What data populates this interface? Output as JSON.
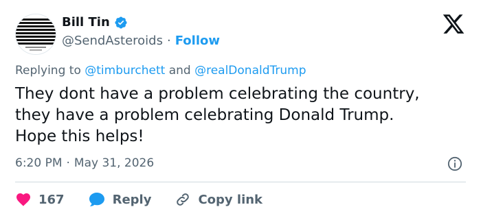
{
  "author": {
    "name": "Bill Tin",
    "handle": "@SendAsteroids",
    "separator": "·",
    "follow_label": "Follow",
    "verified_color": "#1d9bf0",
    "avatar_icon": "striped-avatar"
  },
  "platform_icon": "x-logo-icon",
  "reply_context": {
    "prefix": "Replying to",
    "mention1": "@timburchett",
    "conjunction": "and",
    "mention2": "@realDonaldTrump"
  },
  "tweet": {
    "line1": "They dont have a problem celebrating the country,",
    "line2": "they have a problem celebrating Donald Trump.",
    "line3": "Hope this helps!"
  },
  "meta": {
    "time": "6:20 PM",
    "separator": "·",
    "date": "May 31, 2026"
  },
  "actions": {
    "likes_count": "167",
    "reply_label": "Reply",
    "copy_label": "Copy link"
  },
  "colors": {
    "accent": "#1d9bf0",
    "like": "#f91880",
    "text": "#0f1419",
    "muted": "#536471"
  }
}
